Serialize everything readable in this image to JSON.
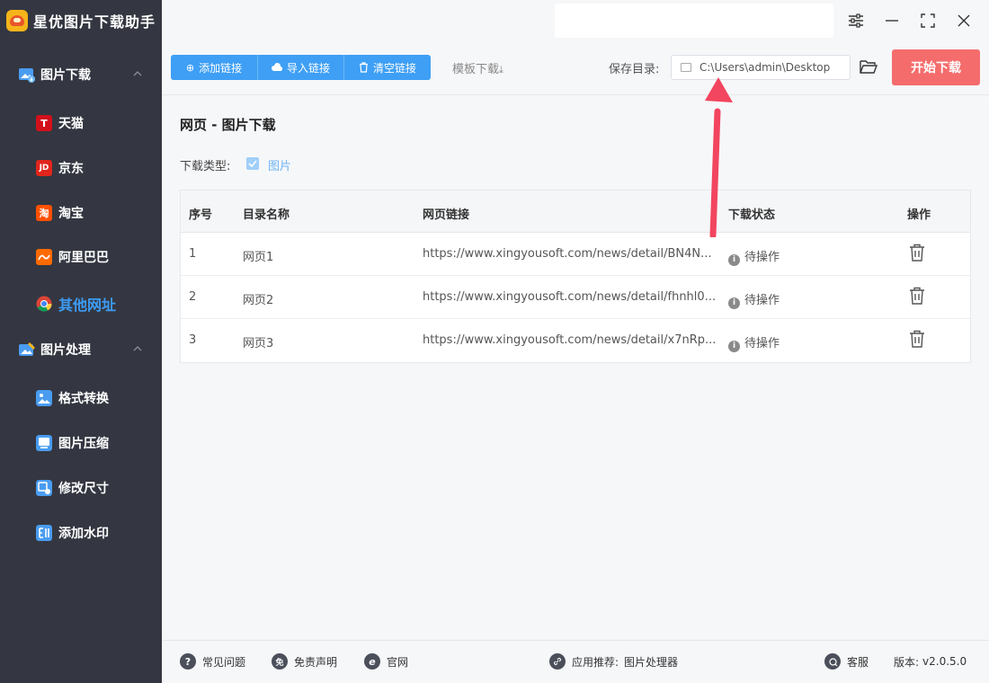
{
  "app": {
    "name": "星优图片下载助手"
  },
  "sidebar": {
    "groups": [
      {
        "label": "图片下载",
        "icon": "image-download-icon"
      },
      {
        "label": "图片处理",
        "icon": "image-process-icon"
      }
    ],
    "download_items": [
      {
        "label": "天猫",
        "icon": "tmall-icon",
        "glyph": "T",
        "color": "#d2101b"
      },
      {
        "label": "京东",
        "icon": "jd-icon",
        "glyph": "JD",
        "color": "#e1251b"
      },
      {
        "label": "淘宝",
        "icon": "taobao-icon",
        "glyph": "淘",
        "color": "#ff5000"
      },
      {
        "label": "阿里巴巴",
        "icon": "alibaba-icon",
        "glyph": "",
        "color": "#ff6a00"
      },
      {
        "label": "其他网址",
        "icon": "chrome-icon",
        "glyph": "",
        "color": "#4285f4"
      }
    ],
    "process_items": [
      {
        "label": "格式转换",
        "icon": "format-convert-icon"
      },
      {
        "label": "图片压缩",
        "icon": "image-compress-icon"
      },
      {
        "label": "修改尺寸",
        "icon": "resize-icon"
      },
      {
        "label": "添加水印",
        "icon": "watermark-icon"
      }
    ]
  },
  "toolbar": {
    "add_link": "添加链接",
    "import_link": "导入链接",
    "clear_link": "清空链接",
    "template_download": "模板下载",
    "save_dir_label": "保存目录:",
    "save_dir_value": "C:\\Users\\admin\\Desktop",
    "start_download": "开始下载"
  },
  "main": {
    "title": "网页 - 图片下载",
    "download_type_label": "下载类型:",
    "download_type_value": "图片",
    "download_type_checked": true
  },
  "table": {
    "headers": [
      "序号",
      "目录名称",
      "网页链接",
      "下载状态",
      "操作"
    ],
    "rows": [
      {
        "index": "1",
        "name": "网页1",
        "link": "https://www.xingyousoft.com/news/detail/BN4N...",
        "status": "待操作"
      },
      {
        "index": "2",
        "name": "网页2",
        "link": "https://www.xingyousoft.com/news/detail/fhnhl0...",
        "status": "待操作"
      },
      {
        "index": "3",
        "name": "网页3",
        "link": "https://www.xingyousoft.com/news/detail/x7nRp...",
        "status": "待操作"
      }
    ]
  },
  "footer": {
    "faq": "常见问题",
    "disclaimer": "免责声明",
    "website": "官网",
    "recommend_label": "应用推荐:",
    "recommend_app": "图片处理器",
    "support": "客服",
    "version_label": "版本:",
    "version": "v2.0.5.0"
  },
  "colors": {
    "accent": "#3e9ff5",
    "start_button": "#f56c6c",
    "sidebar_bg": "#343741",
    "active_nav": "#3d9cf5",
    "annotation_arrow": "#f2455f"
  }
}
